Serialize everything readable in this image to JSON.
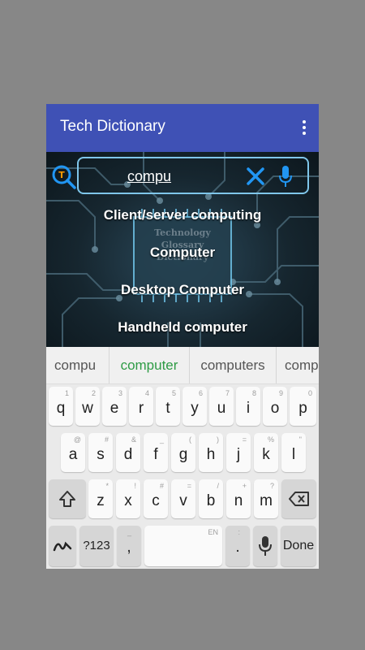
{
  "app": {
    "title": "Tech Dictionary",
    "menu_icon": "overflow-menu-icon"
  },
  "search": {
    "value": "compu",
    "search_icon": "search-icon",
    "clear_icon": "close-icon",
    "mic_icon": "mic-icon",
    "accent_color": "#2196f3"
  },
  "hero": {
    "watermark_lines": [
      "Technology",
      "Glossary",
      "Dictionary"
    ]
  },
  "suggestions": [
    "Client/server computing",
    "Computer",
    "Desktop Computer",
    "Handheld computer"
  ],
  "keyboard": {
    "suggestion_strip": [
      "compu",
      "computer",
      "computers",
      "comp"
    ],
    "rows": [
      [
        "q",
        "w",
        "e",
        "r",
        "t",
        "y",
        "u",
        "i",
        "o",
        "p"
      ],
      [
        "a",
        "s",
        "d",
        "f",
        "g",
        "h",
        "j",
        "k",
        "l"
      ],
      [
        "z",
        "x",
        "c",
        "v",
        "b",
        "n",
        "m"
      ]
    ],
    "hints": {
      "row1": [
        "1",
        "2",
        "3",
        "4",
        "5",
        "6",
        "7",
        "8",
        "9",
        "0"
      ],
      "row2": [
        "@",
        "#",
        "&",
        "_",
        "(",
        ")",
        "=",
        "%",
        "\""
      ],
      "row3": [
        "*",
        "!",
        "#",
        "=",
        "/",
        "+",
        "?"
      ]
    },
    "symbols_label": "?123",
    "comma_label": ",",
    "period_label": ".",
    "space_hint": "EN",
    "done_label": "Done",
    "shift_icon": "shift-icon",
    "backspace_icon": "backspace-icon",
    "handwriting_icon": "handwriting-icon",
    "mic_icon": "mic-icon"
  }
}
